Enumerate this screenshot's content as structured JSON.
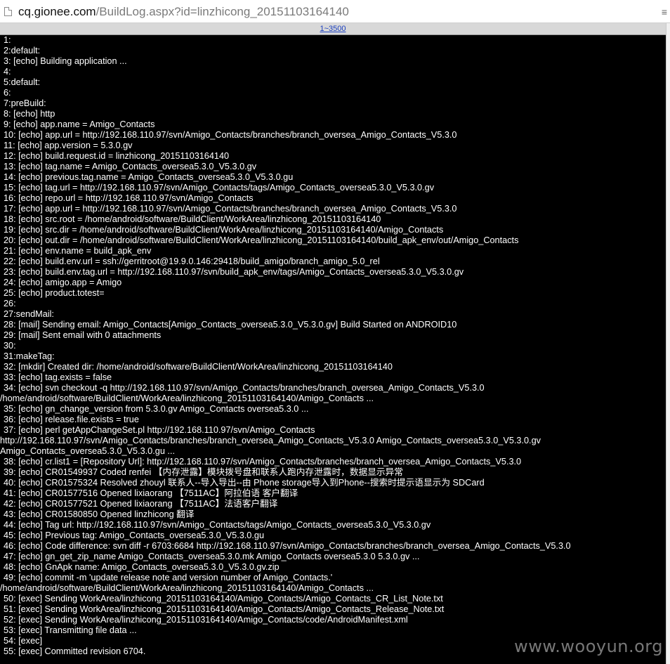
{
  "browser": {
    "url_host": "cq.gionee.com",
    "url_path": "/BuildLog.aspx?id=linzhicong_20151103164140",
    "menu_glyph": "≡"
  },
  "pager": {
    "label": "1~3500"
  },
  "log": {
    "lines": [
      {
        "text": "1:"
      },
      {
        "text": "2:default:"
      },
      {
        "text": "3: [echo] Building application ..."
      },
      {
        "text": "4:"
      },
      {
        "text": "5:default:"
      },
      {
        "text": "6:"
      },
      {
        "text": "7:preBuild:"
      },
      {
        "text": "8: [echo] http"
      },
      {
        "text": "9: [echo] app.name = Amigo_Contacts"
      },
      {
        "text": "10: [echo] app.url = http://192.168.110.97/svn/Amigo_Contacts/branches/branch_oversea_Amigo_Contacts_V5.3.0"
      },
      {
        "text": "11: [echo] app.version = 5.3.0.gv"
      },
      {
        "text": "12: [echo] build.request.id = linzhicong_20151103164140"
      },
      {
        "text": "13: [echo] tag.name = Amigo_Contacts_oversea5.3.0_V5.3.0.gv"
      },
      {
        "text": "14: [echo] previous.tag.name = Amigo_Contacts_oversea5.3.0_V5.3.0.gu"
      },
      {
        "text": "15: [echo] tag.url = http://192.168.110.97/svn/Amigo_Contacts/tags/Amigo_Contacts_oversea5.3.0_V5.3.0.gv"
      },
      {
        "text": "16: [echo] repo.url = http://192.168.110.97/svn/Amigo_Contacts"
      },
      {
        "text": "17: [echo] app.url = http://192.168.110.97/svn/Amigo_Contacts/branches/branch_oversea_Amigo_Contacts_V5.3.0"
      },
      {
        "text": "18: [echo] src.root = /home/android/software/BuildClient/WorkArea/linzhicong_20151103164140"
      },
      {
        "text": "19: [echo] src.dir = /home/android/software/BuildClient/WorkArea/linzhicong_20151103164140/Amigo_Contacts"
      },
      {
        "text": "20: [echo] out.dir = /home/android/software/BuildClient/WorkArea/linzhicong_20151103164140/build_apk_env/out/Amigo_Contacts"
      },
      {
        "text": "21: [echo] env.name = build_apk_env"
      },
      {
        "text": "22: [echo] build.env.url = ssh://gerritroot@19.9.0.146:29418/build_amigo/branch_amigo_5.0_rel"
      },
      {
        "text": "23: [echo] build.env.tag.url = http://192.168.110.97/svn/build_apk_env/tags/Amigo_Contacts_oversea5.3.0_V5.3.0.gv"
      },
      {
        "text": "24: [echo] amigo.app = Amigo"
      },
      {
        "text": "25: [echo] product.totest="
      },
      {
        "text": "26:"
      },
      {
        "text": "27:sendMail:"
      },
      {
        "text": "28: [mail] Sending email: Amigo_Contacts[Amigo_Contacts_oversea5.3.0_V5.3.0.gv] Build Started on ANDROID10"
      },
      {
        "text": "29: [mail] Sent email with 0 attachments"
      },
      {
        "text": "30:"
      },
      {
        "text": "31:makeTag:"
      },
      {
        "text": "32: [mkdir] Created dir: /home/android/software/BuildClient/WorkArea/linzhicong_20151103164140"
      },
      {
        "text": "33: [echo] tag.exists = false"
      },
      {
        "text": "34: [echo] svn checkout -q http://192.168.110.97/svn/Amigo_Contacts/branches/branch_oversea_Amigo_Contacts_V5.3.0"
      },
      {
        "text": "/home/android/software/BuildClient/WorkArea/linzhicong_20151103164140/Amigo_Contacts ...",
        "wrap": true
      },
      {
        "text": "35: [echo] gn_change_version from 5.3.0.gv Amigo_Contacts oversea5.3.0 ..."
      },
      {
        "text": "36: [echo] release.file.exists = true"
      },
      {
        "text": "37: [echo] perl getAppChangeSet.pl http://192.168.110.97/svn/Amigo_Contacts"
      },
      {
        "text": "http://192.168.110.97/svn/Amigo_Contacts/branches/branch_oversea_Amigo_Contacts_V5.3.0 Amigo_Contacts_oversea5.3.0_V5.3.0.gv",
        "wrap": true
      },
      {
        "text": "Amigo_Contacts_oversea5.3.0_V5.3.0.gu ...",
        "wrap": true
      },
      {
        "text": "38: [echo] cr.list1 = [Repository Url]: http://192.168.110.97/svn/Amigo_Contacts/branches/branch_oversea_Amigo_Contacts_V5.3.0"
      },
      {
        "text": "39: [echo] CR01549937 Coded renfei 【内存泄露】模块拨号盘和联系人跑内存泄露时，数据显示异常"
      },
      {
        "text": "40: [echo] CR01575324 Resolved zhouyl 联系人--导入导出--由 Phone storage导入到Phone--搜索时提示语显示为 SDCard"
      },
      {
        "text": "41: [echo] CR01577516 Opened lixiaorang 【7511AC】阿拉伯语 客户翻译"
      },
      {
        "text": "42: [echo] CR01577521 Opened lixiaorang 【7511AC】法语客户翻译"
      },
      {
        "text": "43: [echo] CR01580850 Opened linzhicong 翻译"
      },
      {
        "text": "44: [echo] Tag url: http://192.168.110.97/svn/Amigo_Contacts/tags/Amigo_Contacts_oversea5.3.0_V5.3.0.gv"
      },
      {
        "text": "45: [echo] Previous tag: Amigo_Contacts_oversea5.3.0_V5.3.0.gu"
      },
      {
        "text": "46: [echo] Code difference: svn diff -r 6703:6684 http://192.168.110.97/svn/Amigo_Contacts/branches/branch_oversea_Amigo_Contacts_V5.3.0"
      },
      {
        "text": "47: [echo] gn_get_zip_name Amigo_Contacts_oversea5.3.0.mk Amigo_Contacts oversea5.3.0 5.3.0.gv ..."
      },
      {
        "text": "48: [echo] GnApk name: Amigo_Contacts_oversea5.3.0_V5.3.0.gv.zip"
      },
      {
        "text": "49: [echo] commit -m 'update release note and version number of Amigo_Contacts.'"
      },
      {
        "text": "/home/android/software/BuildClient/WorkArea/linzhicong_20151103164140/Amigo_Contacts ...",
        "wrap": true
      },
      {
        "text": "50: [exec] Sending WorkArea/linzhicong_20151103164140/Amigo_Contacts/Amigo_Contacts_CR_List_Note.txt"
      },
      {
        "text": "51: [exec] Sending WorkArea/linzhicong_20151103164140/Amigo_Contacts/Amigo_Contacts_Release_Note.txt"
      },
      {
        "text": "52: [exec] Sending WorkArea/linzhicong_20151103164140/Amigo_Contacts/code/AndroidManifest.xml"
      },
      {
        "text": "53: [exec] Transmitting file data ..."
      },
      {
        "text": "54: [exec]"
      },
      {
        "text": "55: [exec] Committed revision 6704."
      }
    ]
  },
  "watermark": "www.wooyun.org"
}
